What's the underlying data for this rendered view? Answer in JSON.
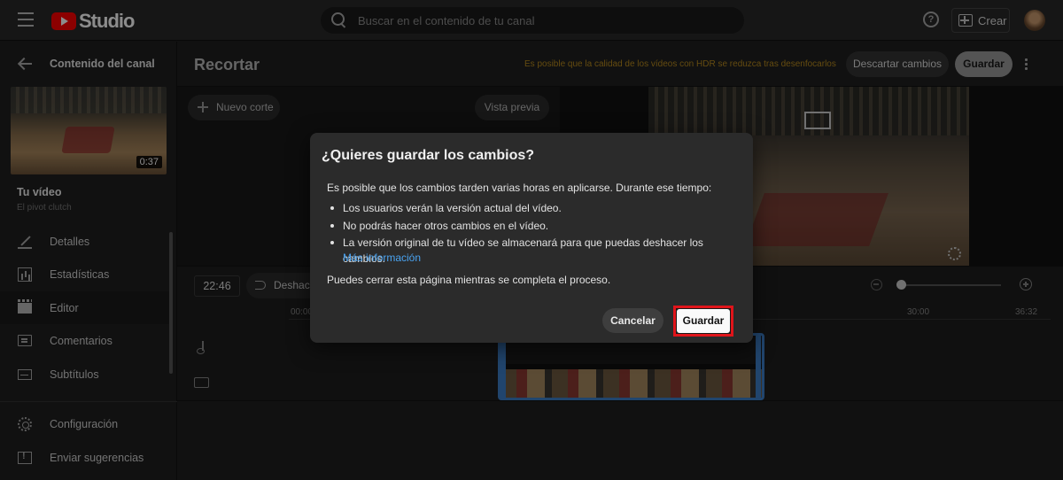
{
  "topbar": {
    "logo_text": "Studio",
    "search_placeholder": "Buscar en el contenido de tu canal",
    "help_glyph": "?",
    "create_label": "Crear"
  },
  "sidebar": {
    "back_label": "Contenido del canal",
    "thumbnail_duration": "0:37",
    "your_video_label": "Tu vídeo",
    "video_title": "El pivot clutch",
    "items": [
      {
        "label": "Detalles",
        "icon": "pencil-icon"
      },
      {
        "label": "Estadísticas",
        "icon": "stats-icon"
      },
      {
        "label": "Editor",
        "icon": "editor-icon",
        "active": true
      },
      {
        "label": "Comentarios",
        "icon": "comments-icon"
      },
      {
        "label": "Subtítulos",
        "icon": "subtitles-icon"
      }
    ],
    "footer": [
      {
        "label": "Configuración",
        "icon": "gear-icon"
      },
      {
        "label": "Enviar sugerencias",
        "icon": "feedback-icon"
      }
    ]
  },
  "header": {
    "title": "Recortar",
    "warning": "Es posible que la calidad de los vídeos con HDR se reduzca tras desenfocarlos",
    "discard_label": "Descartar cambios",
    "save_label": "Guardar"
  },
  "cut_panel": {
    "new_cut_label": "Nuevo corte",
    "preview_label": "Vista previa"
  },
  "timeline": {
    "current_time": "22:46",
    "undo_label": "Deshacer",
    "ticks": [
      "00:00",
      "30:00",
      "36:32"
    ]
  },
  "modal": {
    "title": "¿Quieres guardar los cambios?",
    "intro": "Es posible que los cambios tarden varias horas en aplicarse. Durante ese tiempo:",
    "bullets": [
      "Los usuarios verán la versión actual del vídeo.",
      "No podrás hacer otros cambios en el vídeo.",
      "La versión original de tu vídeo se almacenará para que puedas deshacer los cambios."
    ],
    "more_info": "Más información",
    "note": "Puedes cerrar esta página mientras se completa el proceso.",
    "cancel_label": "Cancelar",
    "save_label": "Guardar"
  },
  "colors": {
    "brand_red": "#ff0000",
    "link_blue": "#4aa3f0",
    "warning_amber": "#b88a1e",
    "highlight_red": "#e0141a",
    "clip_blue": "#3d7ec7"
  }
}
